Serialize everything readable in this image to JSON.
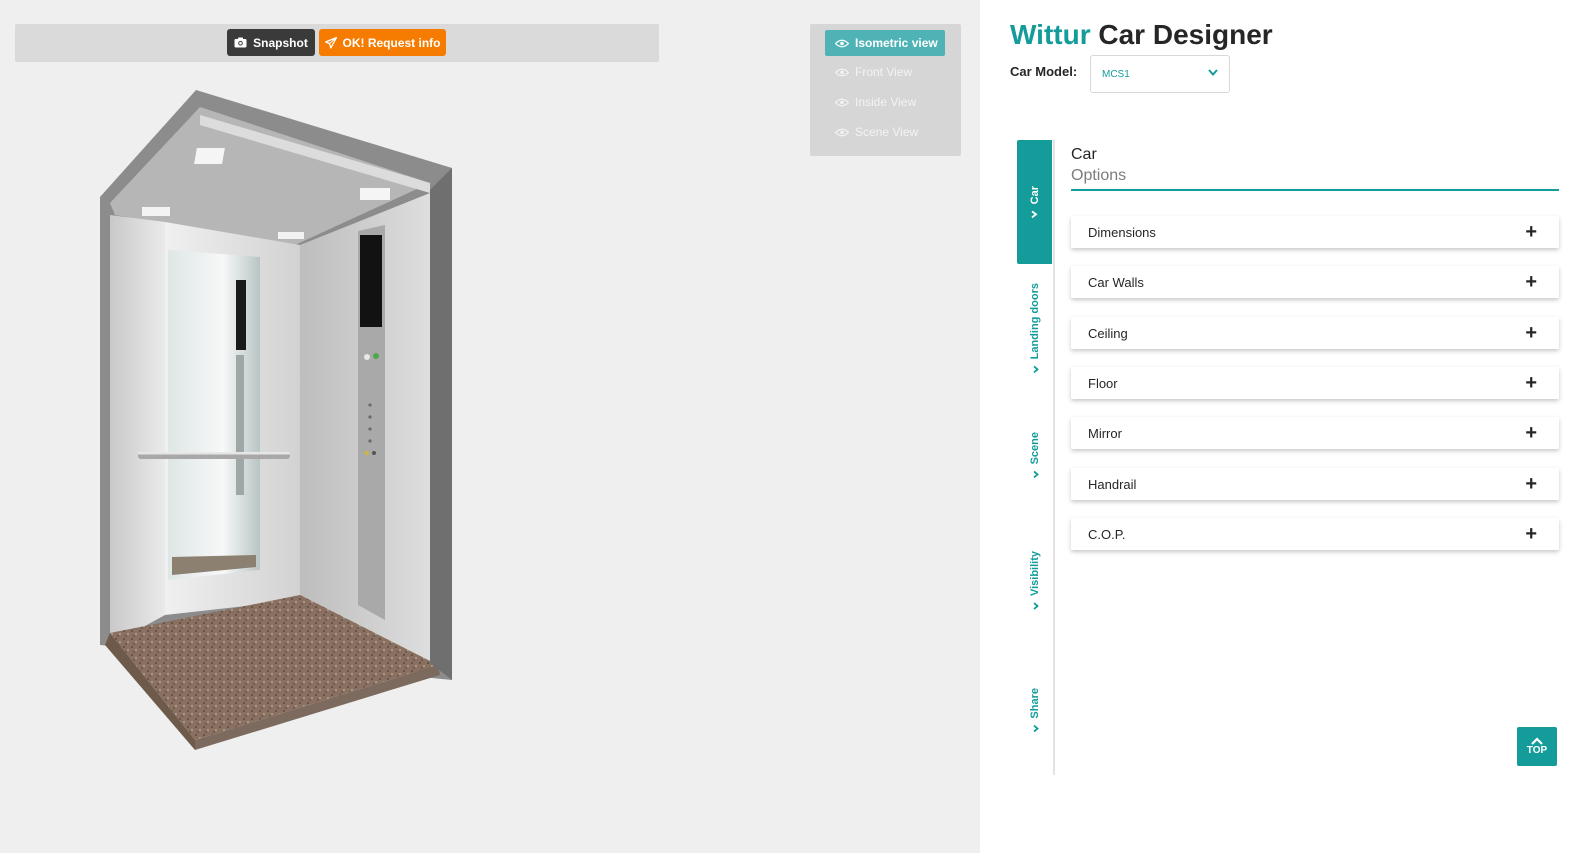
{
  "toolbar": {
    "snapshot_label": "Snapshot",
    "request_label": "OK! Request info"
  },
  "views": {
    "items": [
      {
        "label": "Isometric view",
        "active": true
      },
      {
        "label": "Front View",
        "active": false
      },
      {
        "label": "Inside View",
        "active": false
      },
      {
        "label": "Scene View",
        "active": false
      }
    ]
  },
  "header": {
    "brand": "Wittur",
    "title_rest": "Car Designer"
  },
  "model": {
    "label": "Car Model:",
    "value": "MCS1"
  },
  "tabs": [
    {
      "label": "Car",
      "active": true
    },
    {
      "label": "Landing doors",
      "active": false
    },
    {
      "label": "Scene",
      "active": false
    },
    {
      "label": "Visibility",
      "active": false
    },
    {
      "label": "Share",
      "active": false
    }
  ],
  "section": {
    "title": "Car",
    "subtitle": "Options"
  },
  "options": [
    {
      "label": "Dimensions"
    },
    {
      "label": "Car Walls"
    },
    {
      "label": "Ceiling"
    },
    {
      "label": "Floor"
    },
    {
      "label": "Mirror"
    },
    {
      "label": "Handrail"
    },
    {
      "label": "C.O.P."
    }
  ],
  "top_button": {
    "label": "TOP"
  },
  "colors": {
    "accent": "#139c9a",
    "request": "#f57c00",
    "active_view": "#4fb3b6"
  }
}
